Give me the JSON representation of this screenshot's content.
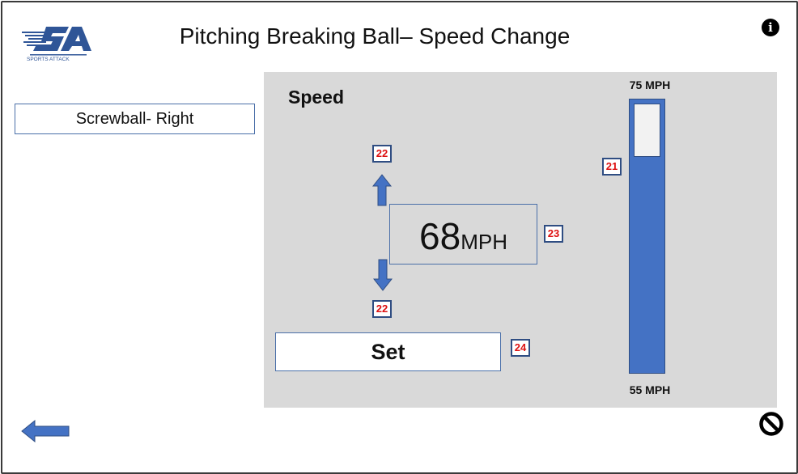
{
  "header": {
    "title": "Pitching Breaking Ball– Speed Change",
    "logo_text": "SPORTS ATTACK"
  },
  "pitch": {
    "selected": "Screwball- Right"
  },
  "speed": {
    "label": "Speed",
    "value": "68",
    "unit": "MPH",
    "set_label": "Set",
    "gauge": {
      "max_label": "75 MPH",
      "min_label": "55 MPH",
      "level": 0.8
    }
  },
  "tags": {
    "up": "22",
    "down": "22",
    "gauge": "21",
    "display": "23",
    "set": "24"
  },
  "colors": {
    "accent": "#4472c4",
    "tag_text": "#dd1111",
    "panel": "#d9d9d9"
  },
  "icons": {
    "info": "info-icon",
    "back": "back-arrow-icon",
    "cancel": "cancel-icon"
  }
}
